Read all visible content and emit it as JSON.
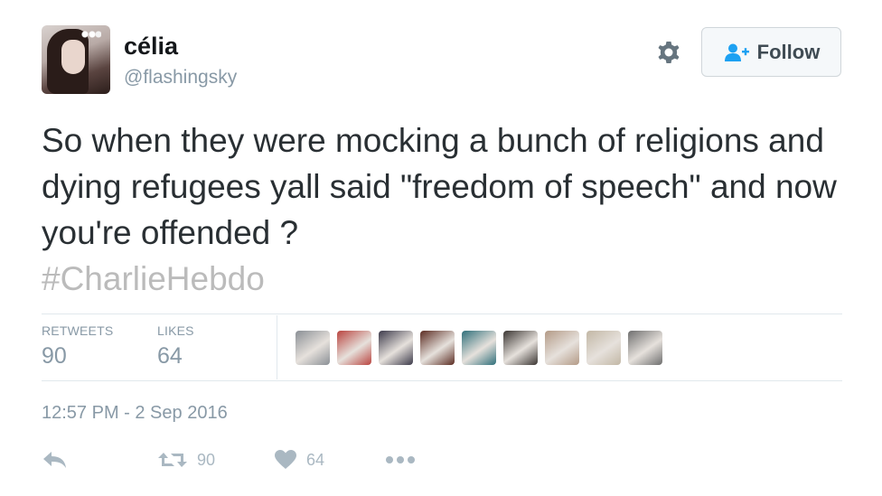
{
  "user": {
    "display_name": "célia",
    "handle": "@flashingsky",
    "avatar_icon": "profile-photo"
  },
  "header": {
    "settings_icon": "gear-icon",
    "follow_label": "Follow",
    "follow_icon": "add-user-icon"
  },
  "tweet": {
    "text": "So when they were mocking a bunch of religions and dying refugees yall said \"freedom of speech\" and now you're offended ?",
    "hashtag": "#CharlieHebdo"
  },
  "stats": {
    "retweets_label": "RETWEETS",
    "retweets_value": "90",
    "likes_label": "LIKES",
    "likes_value": "64"
  },
  "likers": [
    {
      "icon": "liker-avatar",
      "color": "#8a8f95"
    },
    {
      "icon": "liker-avatar",
      "color": "#b9443f"
    },
    {
      "icon": "liker-avatar",
      "color": "#3c3a4a"
    },
    {
      "icon": "liker-avatar",
      "color": "#5b2c22"
    },
    {
      "icon": "liker-avatar",
      "color": "#2f6f7a"
    },
    {
      "icon": "liker-avatar",
      "color": "#3a3532"
    },
    {
      "icon": "liker-avatar",
      "color": "#b39a86"
    },
    {
      "icon": "liker-avatar",
      "color": "#c2b7a5"
    },
    {
      "icon": "liker-avatar",
      "color": "#6e6e6e"
    }
  ],
  "timestamp": "12:57 PM - 2 Sep 2016",
  "actions": {
    "reply_icon": "reply-icon",
    "retweet_icon": "retweet-icon",
    "retweet_count": "90",
    "like_icon": "heart-icon",
    "like_count": "64",
    "more_icon": "more-icon"
  },
  "colors": {
    "muted": "#8899a6",
    "action_icon": "#aab8c2",
    "hashtag": "#bbbbbb",
    "follow_text": "#3f4b53",
    "follow_icon": "#1da1f2"
  }
}
